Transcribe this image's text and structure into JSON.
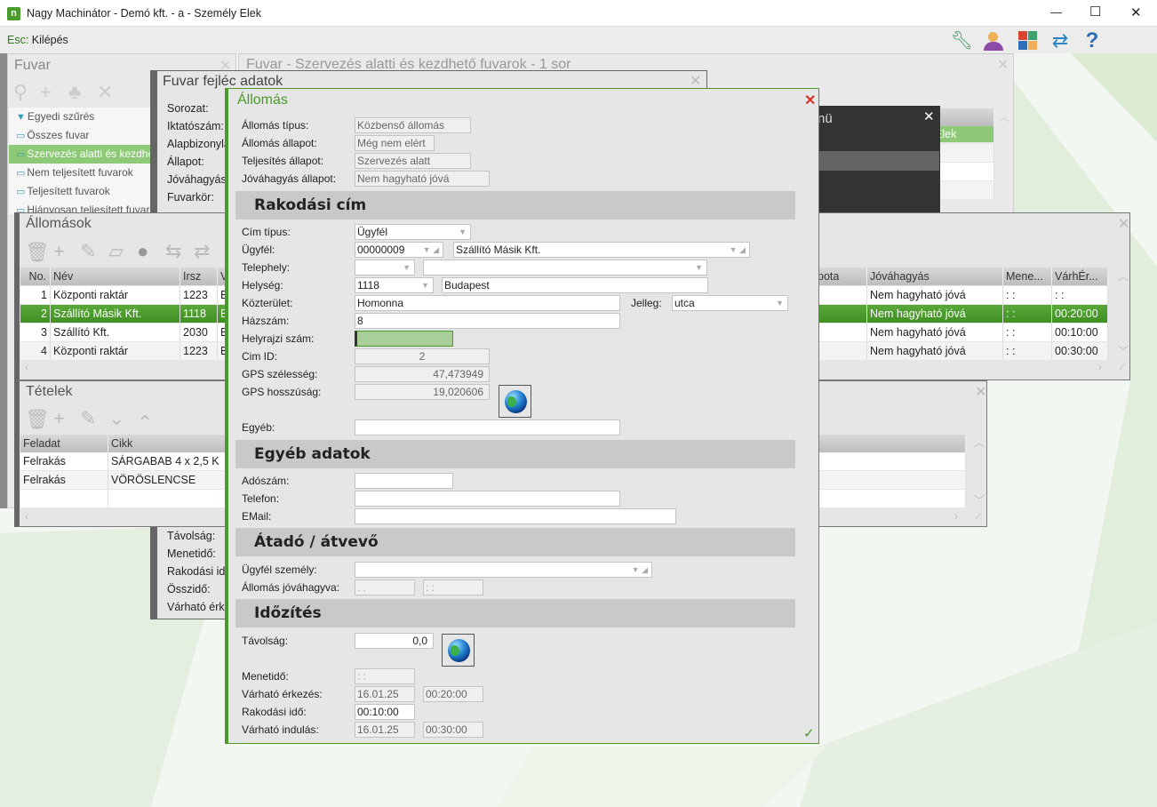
{
  "window": {
    "title": "Nagy Machinátor - Demó kft. - a - Személy Elek",
    "minimize": "—",
    "maximize": "☐",
    "close": "✕"
  },
  "menubar": {
    "esc_key": "Esc:",
    "esc_label": "Kilépés"
  },
  "toolbar_icons": [
    "wrench-icon",
    "user-icon",
    "apps-icon",
    "sync-icon",
    "help-icon"
  ],
  "colors": {
    "accent": "#4a9a2c",
    "selected_row": "#3f8f22",
    "dialog_title": "#4a9a2c",
    "close_red": "#d9342b"
  },
  "fuvar_panel": {
    "title": "Fuvar",
    "close": "✕",
    "items": [
      {
        "label": "Egyedi szűrés",
        "icon": "filter-icon"
      },
      {
        "label": "Összes fuvar",
        "icon": "monitor-icon"
      },
      {
        "label": "Szervezés alatti és kezdhető fuvarok",
        "icon": "monitor-icon",
        "selected": true
      },
      {
        "label": "Nem teljesített fuvarok",
        "icon": "monitor-icon"
      },
      {
        "label": "Teljesített fuvarok",
        "icon": "monitor-icon"
      },
      {
        "label": "Hiányosan teljesített fuvarok",
        "icon": "monitor-icon"
      }
    ]
  },
  "fuvar_list": {
    "title": "Fuvar - Szervezés alatti és kezdhető fuvarok - 1 sor",
    "close": "✕",
    "header_fragment": "v",
    "cell_fragment": "Elek"
  },
  "menu_popup": {
    "title_fragment": "nü",
    "close": "✕"
  },
  "fejlec": {
    "title": "Fuvar fejléc adatok",
    "close": "✕",
    "labels_top": [
      "Sorozat:",
      "Iktatószám:",
      "Alapbizonylat:",
      "Állapot:",
      "Jóváhagyás:",
      "Fuvarkör:"
    ],
    "labels_bottom": [
      "Távolság:",
      "Menetidő:",
      "Rakodási idő:",
      "Összidő:",
      "Várható érkezés:"
    ]
  },
  "allomasok": {
    "title": "Állomások",
    "close": "✕",
    "columns": [
      "No.",
      "Név",
      "Irsz",
      "V",
      "pota",
      "Jóváhagyás",
      "Mene...",
      "VárhÉr..."
    ],
    "rows": [
      {
        "no": "1",
        "nev": "Központi raktár",
        "irsz": "1223",
        "v": "B",
        "jovahagyas": "Nem hagyható jóvá",
        "mene": ":  :",
        "varh": ":  :"
      },
      {
        "no": "2",
        "nev": "Szállító Másik Kft.",
        "irsz": "1118",
        "v": "B",
        "jovahagyas": "Nem hagyható jóvá",
        "mene": ":  :",
        "varh": "00:20:00",
        "selected": true
      },
      {
        "no": "3",
        "nev": "Szállító Kft.",
        "irsz": "2030",
        "v": "B",
        "jovahagyas": "Nem hagyható jóvá",
        "mene": ":  :",
        "varh": "00:10:00"
      },
      {
        "no": "4",
        "nev": "Központi raktár",
        "irsz": "1223",
        "v": "B",
        "jovahagyas": "Nem hagyható jóvá",
        "mene": ":  :",
        "varh": "00:30:00"
      }
    ]
  },
  "tetelek": {
    "title": "Tételek",
    "close": "✕",
    "columns": [
      "Feladat",
      "Cikk"
    ],
    "rows": [
      {
        "feladat": "Felrakás",
        "cikk": "SÁRGABAB 4 x 2,5 K"
      },
      {
        "feladat": "Felrakás",
        "cikk": "VÖRÖSLENCSE"
      }
    ]
  },
  "dialog": {
    "title": "Állomás",
    "close": "✕",
    "ok": "✓",
    "header": {
      "allomas_tipus": {
        "label": "Állomás típus:",
        "value": "Közbenső állomás"
      },
      "allomas_allapot": {
        "label": "Állomás állapot:",
        "value": "Még nem elért"
      },
      "teljesites_allapot": {
        "label": "Teljesítés állapot:",
        "value": "Szervezés alatt"
      },
      "jovahagyas_allapot": {
        "label": "Jóváhagyás állapot:",
        "value": "Nem hagyható jóvá"
      }
    },
    "rakodasi_cim": {
      "title": "Rakodási cím",
      "cim_tipus": {
        "label": "Cím típus:",
        "value": "Ügyfél"
      },
      "ugyfel": {
        "label": "Ügyfél:",
        "code": "00000009",
        "name": "Szállító Másik Kft."
      },
      "telephely": {
        "label": "Telephely:",
        "code": "",
        "name": ""
      },
      "helyseg": {
        "label": "Helység:",
        "zip": "1118",
        "city": "Budapest"
      },
      "kozterulet": {
        "label": "Közterület:",
        "value": "Homonna"
      },
      "jelleg": {
        "label": "Jelleg:",
        "value": "utca"
      },
      "hazszam": {
        "label": "Házszám:",
        "value": "8"
      },
      "helyrajzi": {
        "label": "Helyrajzi szám:",
        "value": ""
      },
      "cim_id": {
        "label": "Cim ID:",
        "value": "2"
      },
      "gps_szel": {
        "label": "GPS szélesség:",
        "value": "47,473949"
      },
      "gps_hossz": {
        "label": "GPS hosszúság:",
        "value": "19,020606"
      },
      "egyeb": {
        "label": "Egyéb:",
        "value": ""
      }
    },
    "egyeb_adatok": {
      "title": "Egyéb adatok",
      "adoszam": {
        "label": "Adószám:",
        "value": ""
      },
      "telefon": {
        "label": "Telefon:",
        "value": ""
      },
      "email": {
        "label": "EMail:",
        "value": ""
      }
    },
    "atado": {
      "title": "Átadó / átvevő",
      "ugyfel_szemely": {
        "label": "Ügyfél személy:",
        "value": ""
      },
      "jovahagyva": {
        "label": "Állomás jóváhagyva:",
        "date": " .  .",
        "time": " :  :"
      }
    },
    "idozites": {
      "title": "Időzítés",
      "tavolsag": {
        "label": "Távolság:",
        "value": "0,0"
      },
      "menetido": {
        "label": "Menetidő:",
        "value": " :  :"
      },
      "varhato_erkezes": {
        "label": "Várható érkezés:",
        "date": "16.01.25",
        "time": "00:20:00"
      },
      "rakodasi_ido": {
        "label": "Rakodási idő:",
        "value": "00:10:00"
      },
      "varhato_indulas": {
        "label": "Várható indulás:",
        "date": "16.01.25",
        "time": "00:30:00"
      }
    }
  }
}
